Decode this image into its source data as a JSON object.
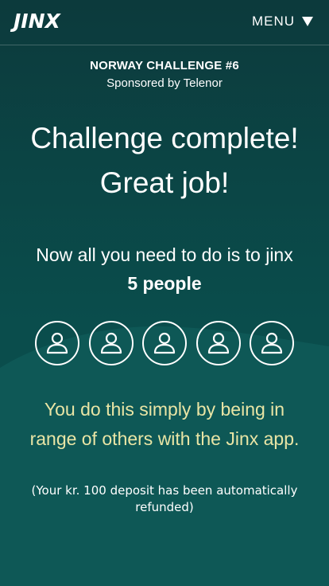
{
  "header": {
    "logo_text": "JINX",
    "menu_label": "MENU"
  },
  "challenge": {
    "title": "NORWAY CHALLENGE #6",
    "sponsor": "Sponsored by Telenor"
  },
  "main": {
    "headline_line1": "Challenge complete!",
    "headline_line2": "Great job!",
    "instruction": "Now all you need to do is to jinx",
    "people_count": "5 people",
    "explanation_line1": "You do this simply by being in",
    "explanation_line2": "range of others with the Jinx app.",
    "refund_note": "(Your kr. 100 deposit has been automatically refunded)"
  },
  "avatars": [
    "person-icon",
    "person-icon",
    "person-icon",
    "person-icon",
    "person-icon"
  ],
  "colors": {
    "background_top": "#0c3a3c",
    "background_bottom": "#094d4c",
    "wave": "#0e5856",
    "accent_text": "#e9e5a5",
    "text": "#ffffff"
  }
}
